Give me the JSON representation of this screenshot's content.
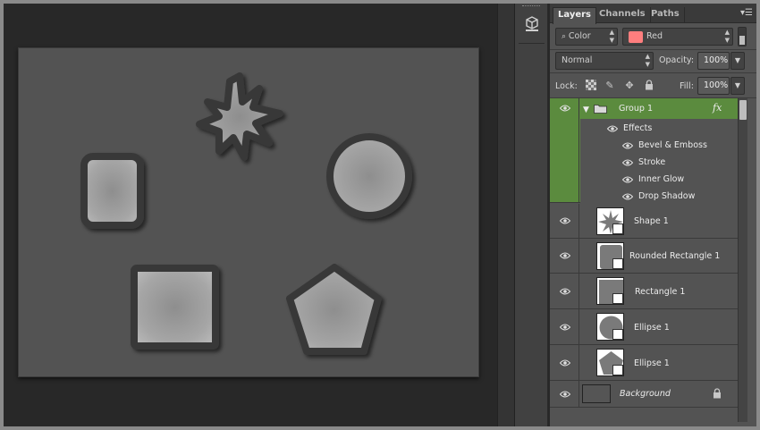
{
  "panel": {
    "tabs": [
      {
        "label": "Layers",
        "active": true
      },
      {
        "label": "Channels",
        "active": false
      },
      {
        "label": "Paths",
        "active": false
      }
    ],
    "filter": {
      "kind": "Color",
      "value": "Red",
      "swatch_color": "#ff7e7e"
    },
    "blend_mode": "Normal",
    "opacity_label": "Opacity:",
    "opacity_value": "100%",
    "lock_label": "Lock:",
    "fill_label": "Fill:",
    "fill_value": "100%"
  },
  "layers": {
    "group": {
      "name": "Group 1",
      "fx": "fx",
      "effects_label": "Effects",
      "effects": [
        "Bevel & Emboss",
        "Stroke",
        "Inner Glow",
        "Drop Shadow"
      ],
      "highlight_color": "#5b8b3e"
    },
    "items": [
      {
        "name": "Shape 1",
        "thumb": "star"
      },
      {
        "name": "Rounded Rectangle 1",
        "thumb": "rounded-rect"
      },
      {
        "name": "Rectangle 1",
        "thumb": "rect"
      },
      {
        "name": "Ellipse 1",
        "thumb": "ellipse"
      },
      {
        "name": "Ellipse 1",
        "thumb": "pentagon"
      }
    ],
    "background": {
      "name": "Background",
      "locked": true
    }
  },
  "canvas": {
    "background_color": "#535353",
    "shape_fill": "#9d9d9d",
    "shape_stroke": "#383838"
  }
}
